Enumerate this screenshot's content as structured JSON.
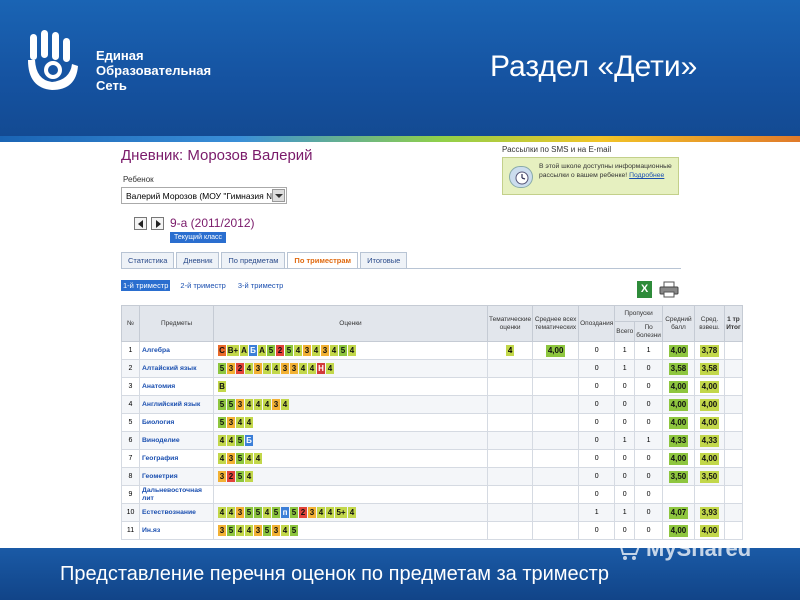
{
  "brand": {
    "name_lines": [
      "Единая",
      "Образовательная",
      "Сеть"
    ],
    "logo_icon": "open-hand-logo-icon"
  },
  "slide": {
    "title": "Раздел «Дети»",
    "caption": "Представление перечня оценок  по предметам за триместр",
    "watermark": "MyShared"
  },
  "diary": {
    "title": "Дневник: Морозов Валерий",
    "child_label": "Ребенок",
    "child_value": "Валерий Морозов (МОУ \"Гимназия №",
    "class_label": "9-а (2011/2012)",
    "current_class_badge": "Текущий класс"
  },
  "sms": {
    "label": "Рассылки по SMS и на E-mail",
    "text": "В этой школе доступны информационные рассылки о вашем ребенке!",
    "link": "Подробнее"
  },
  "tabs": [
    {
      "label": "Статистика",
      "active": false
    },
    {
      "label": "Дневник",
      "active": false
    },
    {
      "label": "По предметам",
      "active": false
    },
    {
      "label": "По триместрам",
      "active": true
    },
    {
      "label": "Итоговые",
      "active": false
    }
  ],
  "trimesters": [
    {
      "label": "1-й триместр",
      "active": true
    },
    {
      "label": "2-й триместр",
      "active": false
    },
    {
      "label": "3-й триместр",
      "active": false
    }
  ],
  "table": {
    "headers": {
      "num": "№",
      "subject": "Предметы",
      "marks": "Оценки",
      "thematic": "Тематические оценки",
      "avg_thematic": "Среднее всех тематических",
      "late": "Опоздания",
      "absences": "Пропуски",
      "abs_total": "Всего",
      "abs_sick": "По болезни",
      "avg_score": "Средний балл",
      "weighted": "Сред. взвеш.",
      "tri1": "1 тр",
      "tri1_sub": "Итог"
    },
    "rows": [
      {
        "num": "1",
        "subject": "Алгебра",
        "marks": [
          "C",
          "B+",
          "A",
          "Б",
          "A",
          "5",
          "2",
          "5",
          "4",
          "3",
          "4",
          "3",
          "4",
          "5",
          "4"
        ],
        "thematic": "4",
        "avg_thematic": "4,00",
        "late": "0",
        "abs_total": "1",
        "abs_sick": "1",
        "avg": "4,00",
        "weighted": "3,78"
      },
      {
        "num": "2",
        "subject": "Алтайский язык",
        "marks": [
          "5",
          "3",
          "2",
          "4",
          "3",
          "4",
          "4",
          "3",
          "3",
          "4",
          "4",
          "Н",
          "4"
        ],
        "thematic": "",
        "avg_thematic": "",
        "late": "0",
        "abs_total": "1",
        "abs_sick": "0",
        "avg": "3,58",
        "weighted": "3,58"
      },
      {
        "num": "3",
        "subject": "Анатомия",
        "marks": [
          "B"
        ],
        "thematic": "",
        "avg_thematic": "",
        "late": "0",
        "abs_total": "0",
        "abs_sick": "0",
        "avg": "4,00",
        "weighted": "4,00"
      },
      {
        "num": "4",
        "subject": "Английский язык",
        "marks": [
          "5",
          "5",
          "3",
          "4",
          "4",
          "4",
          "3",
          "4"
        ],
        "thematic": "",
        "avg_thematic": "",
        "late": "0",
        "abs_total": "0",
        "abs_sick": "0",
        "avg": "4,00",
        "weighted": "4,00"
      },
      {
        "num": "5",
        "subject": "Биология",
        "marks": [
          "5",
          "3",
          "4",
          "4"
        ],
        "thematic": "",
        "avg_thematic": "",
        "late": "0",
        "abs_total": "0",
        "abs_sick": "0",
        "avg": "4,00",
        "weighted": "4,00"
      },
      {
        "num": "6",
        "subject": "Виноделие",
        "marks": [
          "4",
          "4",
          "5",
          "Б"
        ],
        "thematic": "",
        "avg_thematic": "",
        "late": "0",
        "abs_total": "1",
        "abs_sick": "1",
        "avg": "4,33",
        "weighted": "4,33"
      },
      {
        "num": "7",
        "subject": "География",
        "marks": [
          "4",
          "3",
          "5",
          "4",
          "4"
        ],
        "thematic": "",
        "avg_thematic": "",
        "late": "0",
        "abs_total": "0",
        "abs_sick": "0",
        "avg": "4,00",
        "weighted": "4,00"
      },
      {
        "num": "8",
        "subject": "Геометрия",
        "marks": [
          "3",
          "2",
          "5",
          "4"
        ],
        "thematic": "",
        "avg_thematic": "",
        "late": "0",
        "abs_total": "0",
        "abs_sick": "0",
        "avg": "3,50",
        "weighted": "3,50"
      },
      {
        "num": "9",
        "subject": "Дальневосточная лит",
        "marks": [],
        "thematic": "",
        "avg_thematic": "",
        "late": "0",
        "abs_total": "0",
        "abs_sick": "0",
        "avg": "",
        "weighted": ""
      },
      {
        "num": "10",
        "subject": "Естествознание",
        "marks": [
          "4",
          "4",
          "3",
          "5",
          "5",
          "4",
          "5",
          "п",
          "5",
          "2",
          "3",
          "4",
          "4",
          "5+",
          "4"
        ],
        "thematic": "",
        "avg_thematic": "",
        "late": "1",
        "abs_total": "1",
        "abs_sick": "0",
        "avg": "4,07",
        "weighted": "3,93"
      },
      {
        "num": "11",
        "subject": "Ин.яз",
        "marks": [
          "3",
          "5",
          "4",
          "4",
          "3",
          "5",
          "3",
          "4",
          "5"
        ],
        "thematic": "",
        "avg_thematic": "",
        "late": "0",
        "abs_total": "0",
        "abs_sick": "0",
        "avg": "4,00",
        "weighted": "4,00"
      }
    ]
  },
  "colors": {
    "header_blue": "#1a64b4",
    "grade_5": "#8ec63f",
    "grade_4": "#c2d74a",
    "grade_3": "#f2b134",
    "grade_2": "#e2443a",
    "accent_tab": "#e06a10",
    "title_purple": "#7a1a6a"
  },
  "icons": {
    "excel": "excel-export-icon",
    "print": "printer-icon",
    "sms": "sms-info-icon"
  }
}
